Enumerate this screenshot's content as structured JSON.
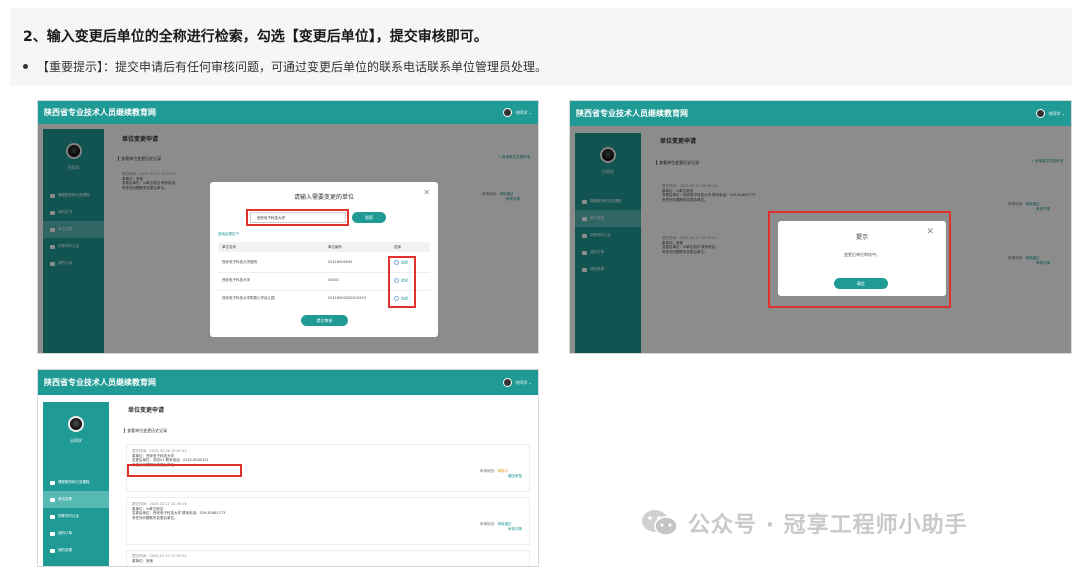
{
  "info": {
    "step_title": "2、输入变更后单位的全称进行检索，勾选【变更后单位】，提交审核即可。",
    "tip": "【重要提示】：提交申请后有任何审核问题，可通过变更后单位的联系电话联系单位管理员处理。"
  },
  "app": {
    "site_title": "陕西省专业技术人员继续教育网",
    "user_short": "刘同学",
    "user_name": "吕同学",
    "page_title": "单位变更申请",
    "history_title": "查看单位变更历史记录",
    "new_change": "+ 新增单位变更申请",
    "nav": [
      "课程服务和已选课程",
      "我的证书",
      "单位变更",
      "同等学时认证",
      "我的订单",
      "我的选课"
    ]
  },
  "screen1": {
    "modal_title": "请输入需要变更的单位",
    "search_value": "西安电子科技大学",
    "search_button": "搜索",
    "result_label": "搜索结果如下：",
    "columns": [
      "单位名称",
      "单位编号",
      "选择"
    ],
    "rows": [
      {
        "name": "西安电子科技大学医院",
        "code": "00118000045",
        "select": "选择"
      },
      {
        "name": "西安电子科技大学",
        "code": "00031",
        "select": "选择"
      },
      {
        "name": "西安电子科技大学附属小学幼儿园",
        "code": "00118000250410333",
        "select": "选择"
      }
    ],
    "submit": "提交审核",
    "bg_record": {
      "time": "提交时间：2025-01-17 17:07:52",
      "orig": "原单位：其他",
      "after": "变更后单位：lv单位测试   联系电话：",
      "note": "有任何问题联系变更后单位。",
      "status": "申请状态：",
      "status_val": "审核通过",
      "detail": "审核详情"
    }
  },
  "screen2": {
    "modal_title": "提示",
    "message": "变更后单位审核中。",
    "confirm": "确定",
    "records": [
      {
        "time": "提交时间：2025-02-17 14:59:16",
        "orig": "原单位：lv单位测试",
        "after": "变更后单位：西安电子科技大学   联系电话：029-81861773",
        "note": "有任何问题联系变更后单位。",
        "status": "申请状态：",
        "status_val": "审核通过",
        "detail": "审核详情"
      },
      {
        "time": "提交时间：2025-01-17 17:07:52",
        "orig": "原单位：其他",
        "after": "变更后单位：lv单位测试   联系电话：",
        "note": "有任何问题联系变更后单位。",
        "status": "申请状态：",
        "status_val": "审核通过",
        "detail": "审核详情"
      }
    ]
  },
  "screen3": {
    "records": [
      {
        "time": "提交时间：2025-02-26 10:07:40",
        "orig": "原单位：西安电子科技大学",
        "after": "变更后单位：测试01   联系电话：0101-8040321",
        "note": "有任何问题联系变更后单位。",
        "status": "申请状态：",
        "status_val": "审核中",
        "detail": "撤回审核"
      },
      {
        "time": "提交时间：2025-02-17 14:59:16",
        "orig": "原单位：lv单位测试",
        "after": "变更后单位：西安电子科技大学   联系电话：029-81861773",
        "note": "有任何问题联系变更后单位。",
        "status": "申请状态：",
        "status_val": "审核通过",
        "detail": "审核详情"
      },
      {
        "time": "提交时间：2025-01-17 17:07:52",
        "orig": "原单位：其他",
        "after": "",
        "note": "",
        "status": "",
        "status_val": "",
        "detail": ""
      }
    ]
  },
  "watermark": "公众号 · 冠享工程师小助手",
  "colors": {
    "brand": "#1f9a95",
    "highlight": "#e0312c"
  }
}
